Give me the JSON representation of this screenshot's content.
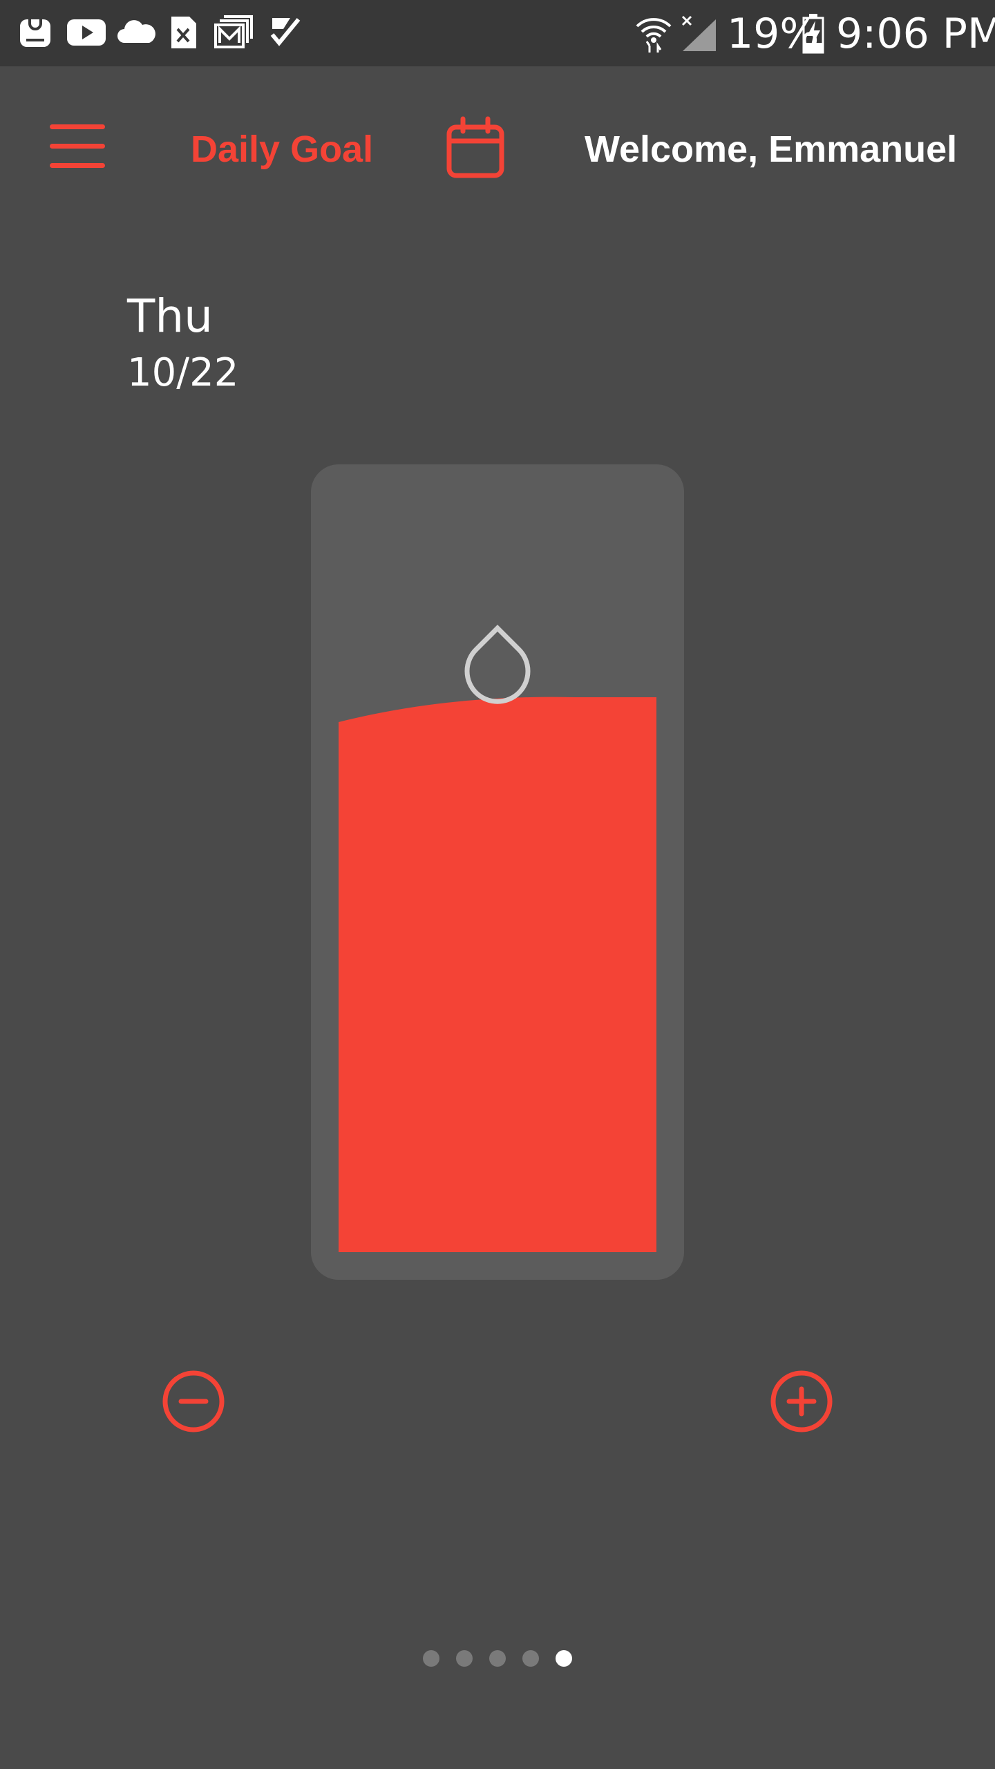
{
  "status_bar": {
    "battery": "19%",
    "time": "9:06 PM",
    "notification_icons": [
      "galaxy-apps-icon",
      "youtube-icon",
      "cloud-icon",
      "excel-icon",
      "gmail-icon",
      "tasks-check-icon"
    ],
    "system_icons": [
      "wifi-icon",
      "signal-off-icon",
      "battery-charging-icon"
    ]
  },
  "header": {
    "menu_icon": "hamburger-menu-icon",
    "title": "Daily Goal",
    "calendar_icon": "calendar-icon",
    "welcome": "Welcome, Emmanuel"
  },
  "date": {
    "day": "Thu",
    "date": "10/22"
  },
  "intake": {
    "fill_fraction": 0.73,
    "drop_icon": "water-drop-icon"
  },
  "controls": {
    "decrease_icon": "minus-circle-icon",
    "increase_icon": "plus-circle-icon"
  },
  "pager": {
    "count": 5,
    "active_index": 4
  },
  "colors": {
    "accent": "#f44336",
    "background": "#4a4a4a",
    "status_bar": "#383838",
    "bottle": "#5c5c5c",
    "drop_outline": "#d0d0d0"
  }
}
